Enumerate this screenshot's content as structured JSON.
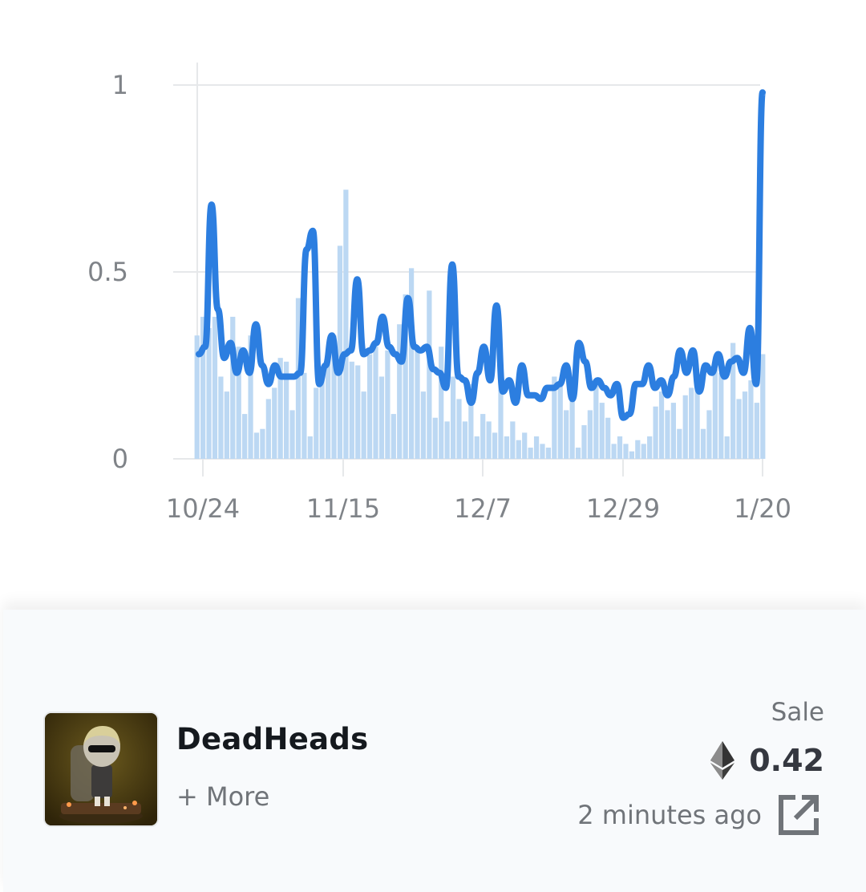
{
  "chart_data": {
    "type": "bar",
    "y_ticks": [
      "1",
      "0.5",
      "0"
    ],
    "x_ticks": [
      "10/24",
      "11/15",
      "12/7",
      "12/29",
      "1/20"
    ],
    "ylim": [
      0,
      1
    ],
    "grid": true,
    "series": [
      {
        "kind": "bar",
        "color": "#bcd8f3",
        "values": [
          0.33,
          0.38,
          0.35,
          0.38,
          0.22,
          0.18,
          0.38,
          0.3,
          0.12,
          0.33,
          0.07,
          0.08,
          0.16,
          0.19,
          0.27,
          0.26,
          0.13,
          0.43,
          0.23,
          0.06,
          0.19,
          0.22,
          0.28,
          0.33,
          0.57,
          0.72,
          0.26,
          0.25,
          0.18,
          0.28,
          0.3,
          0.22,
          0.29,
          0.12,
          0.36,
          0.44,
          0.51,
          0.3,
          0.18,
          0.45,
          0.11,
          0.3,
          0.1,
          0.22,
          0.16,
          0.1,
          0.2,
          0.06,
          0.12,
          0.1,
          0.07,
          0.25,
          0.06,
          0.1,
          0.05,
          0.07,
          0.03,
          0.06,
          0.04,
          0.03,
          0.22,
          0.2,
          0.13,
          0.2,
          0.03,
          0.09,
          0.13,
          0.2,
          0.15,
          0.11,
          0.04,
          0.06,
          0.04,
          0.02,
          0.05,
          0.04,
          0.06,
          0.14,
          0.18,
          0.13,
          0.15,
          0.08,
          0.17,
          0.19,
          0.19,
          0.08,
          0.13,
          0.24,
          0.23,
          0.06,
          0.31,
          0.16,
          0.18,
          0.21,
          0.15,
          0.28
        ]
      },
      {
        "kind": "line",
        "color": "#2c7ee0",
        "values": [
          0.28,
          0.3,
          0.68,
          0.4,
          0.27,
          0.31,
          0.23,
          0.29,
          0.23,
          0.36,
          0.25,
          0.2,
          0.25,
          0.22,
          0.22,
          0.22,
          0.23,
          0.56,
          0.61,
          0.2,
          0.25,
          0.33,
          0.23,
          0.28,
          0.29,
          0.48,
          0.28,
          0.29,
          0.31,
          0.38,
          0.3,
          0.28,
          0.26,
          0.43,
          0.3,
          0.29,
          0.3,
          0.24,
          0.23,
          0.19,
          0.52,
          0.22,
          0.21,
          0.15,
          0.23,
          0.3,
          0.21,
          0.41,
          0.18,
          0.21,
          0.15,
          0.25,
          0.17,
          0.17,
          0.16,
          0.19,
          0.19,
          0.2,
          0.25,
          0.16,
          0.31,
          0.26,
          0.19,
          0.21,
          0.19,
          0.17,
          0.2,
          0.11,
          0.12,
          0.2,
          0.2,
          0.25,
          0.19,
          0.21,
          0.17,
          0.22,
          0.29,
          0.23,
          0.29,
          0.18,
          0.25,
          0.23,
          0.28,
          0.22,
          0.26,
          0.27,
          0.23,
          0.35,
          0.2,
          0.98
        ]
      }
    ]
  },
  "activity": {
    "collection_name": "DeadHeads",
    "more_label": "+ More",
    "event_type": "Sale",
    "price": "0.42",
    "time_ago": "2 minutes ago",
    "currency_icon": "ethereum-icon",
    "link_icon": "external-link-icon"
  }
}
